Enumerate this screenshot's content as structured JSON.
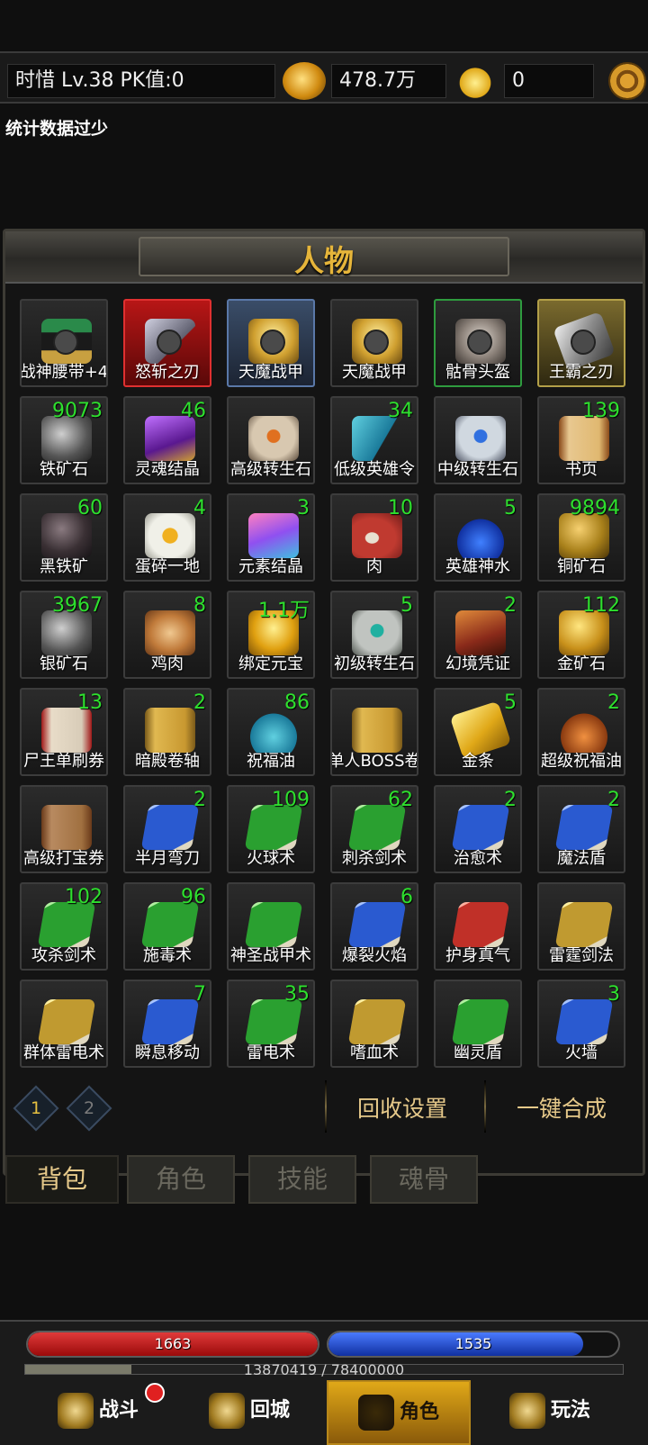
{
  "header": {
    "player": "时惜  Lv.38 PK值:0",
    "gold": "478.7万",
    "ingot": "0",
    "icons": {
      "gold": "gold-coin-icon",
      "ingot": "gold-ingot-icon",
      "settings": "gear-icon"
    }
  },
  "notice": "统计数据过少",
  "panel": {
    "title": "人物"
  },
  "equipment": [
    {
      "name": "战神腰带+4",
      "icon": "belt-icon",
      "frame": "normal"
    },
    {
      "name": "怒斩之刃",
      "icon": "axe-icon",
      "frame": "red"
    },
    {
      "name": "天魔战甲",
      "icon": "armor-icon",
      "frame": "blue"
    },
    {
      "name": "天魔战甲",
      "icon": "armor-icon",
      "frame": "normal"
    },
    {
      "name": "骷骨头盔",
      "icon": "skull-helmet-icon",
      "frame": "green"
    },
    {
      "name": "王霸之刃",
      "icon": "sword-icon",
      "frame": "gold"
    }
  ],
  "items": [
    {
      "name": "铁矿石",
      "count": "9073",
      "icon": "iron-ore-icon"
    },
    {
      "name": "灵魂结晶",
      "count": "46",
      "icon": "soul-crystal-icon"
    },
    {
      "name": "高级转生石",
      "count": "",
      "icon": "rune-stone-icon"
    },
    {
      "name": "低级英雄令",
      "count": "34",
      "icon": "flag-icon"
    },
    {
      "name": "中级转生石",
      "count": "",
      "icon": "rune-stone-icon"
    },
    {
      "name": "书页",
      "count": "139",
      "icon": "scroll-page-icon"
    },
    {
      "name": "黑铁矿",
      "count": "60",
      "icon": "black-iron-icon"
    },
    {
      "name": "蛋碎一地",
      "count": "4",
      "icon": "egg-icon"
    },
    {
      "name": "元素结晶",
      "count": "3",
      "icon": "crystal-icon"
    },
    {
      "name": "肉",
      "count": "10",
      "icon": "meat-icon"
    },
    {
      "name": "英雄神水",
      "count": "5",
      "icon": "blue-potion-icon"
    },
    {
      "name": "铜矿石",
      "count": "9894",
      "icon": "copper-ore-icon"
    },
    {
      "name": "银矿石",
      "count": "3967",
      "icon": "silver-ore-icon"
    },
    {
      "name": "鸡肉",
      "count": "8",
      "icon": "chicken-icon"
    },
    {
      "name": "绑定元宝",
      "count": "1.1万",
      "icon": "gold-ingot-icon"
    },
    {
      "name": "初级转生石",
      "count": "5",
      "icon": "rune-stone-icon"
    },
    {
      "name": "幻境凭证",
      "count": "2",
      "icon": "token-icon"
    },
    {
      "name": "金矿石",
      "count": "112",
      "icon": "gold-ore-icon"
    },
    {
      "name": "尸王单刷券",
      "count": "13",
      "icon": "scroll-icon"
    },
    {
      "name": "暗殿卷轴",
      "count": "2",
      "icon": "scroll-icon"
    },
    {
      "name": "祝福油",
      "count": "86",
      "icon": "teal-potion-icon"
    },
    {
      "name": "单人BOSS卷",
      "count": "",
      "icon": "scroll-icon"
    },
    {
      "name": "金条",
      "count": "5",
      "icon": "gold-bar-icon"
    },
    {
      "name": "超级祝福油",
      "count": "2",
      "icon": "orange-potion-icon"
    },
    {
      "name": "高级打宝券",
      "count": "",
      "icon": "scroll-icon"
    },
    {
      "name": "半月弯刀",
      "count": "2",
      "icon": "skill-book-icon"
    },
    {
      "name": "火球术",
      "count": "109",
      "icon": "skill-book-icon"
    },
    {
      "name": "刺杀剑术",
      "count": "62",
      "icon": "skill-book-icon"
    },
    {
      "name": "治愈术",
      "count": "2",
      "icon": "skill-book-icon"
    },
    {
      "name": "魔法盾",
      "count": "2",
      "icon": "skill-book-icon"
    },
    {
      "name": "攻杀剑术",
      "count": "102",
      "icon": "skill-book-icon"
    },
    {
      "name": "施毒术",
      "count": "96",
      "icon": "skill-book-icon"
    },
    {
      "name": "神圣战甲术",
      "count": "",
      "icon": "skill-book-icon"
    },
    {
      "name": "爆裂火焰",
      "count": "6",
      "icon": "skill-book-icon"
    },
    {
      "name": "护身真气",
      "count": "",
      "icon": "skill-book-icon"
    },
    {
      "name": "雷霆剑法",
      "count": "",
      "icon": "skill-book-icon"
    },
    {
      "name": "群体雷电术",
      "count": "",
      "icon": "skill-book-icon"
    },
    {
      "name": "瞬息移动",
      "count": "7",
      "icon": "skill-book-icon"
    },
    {
      "name": "雷电术",
      "count": "35",
      "icon": "skill-book-icon"
    },
    {
      "name": "嗜血术",
      "count": "",
      "icon": "skill-book-icon"
    },
    {
      "name": "幽灵盾",
      "count": "",
      "icon": "skill-book-icon"
    },
    {
      "name": "火墙",
      "count": "3",
      "icon": "skill-book-icon"
    }
  ],
  "pages": [
    "1",
    "2"
  ],
  "actions": {
    "recycle": "回收设置",
    "merge": "一键合成"
  },
  "tabs": [
    "背包",
    "角色",
    "技能",
    "魂骨"
  ],
  "status": {
    "hp": "1663",
    "mp": "1535",
    "mp_fraction": 0.88,
    "exp": "13870419 / 78400000",
    "exp_fraction": 0.177
  },
  "nav": [
    "战斗",
    "回城",
    "角色",
    "玩法"
  ],
  "colors": {
    "count": "#2ee02e",
    "title": "#e6b53a",
    "action": "#e6c98a",
    "hp": "#c01818",
    "mp": "#1a4ad0"
  }
}
